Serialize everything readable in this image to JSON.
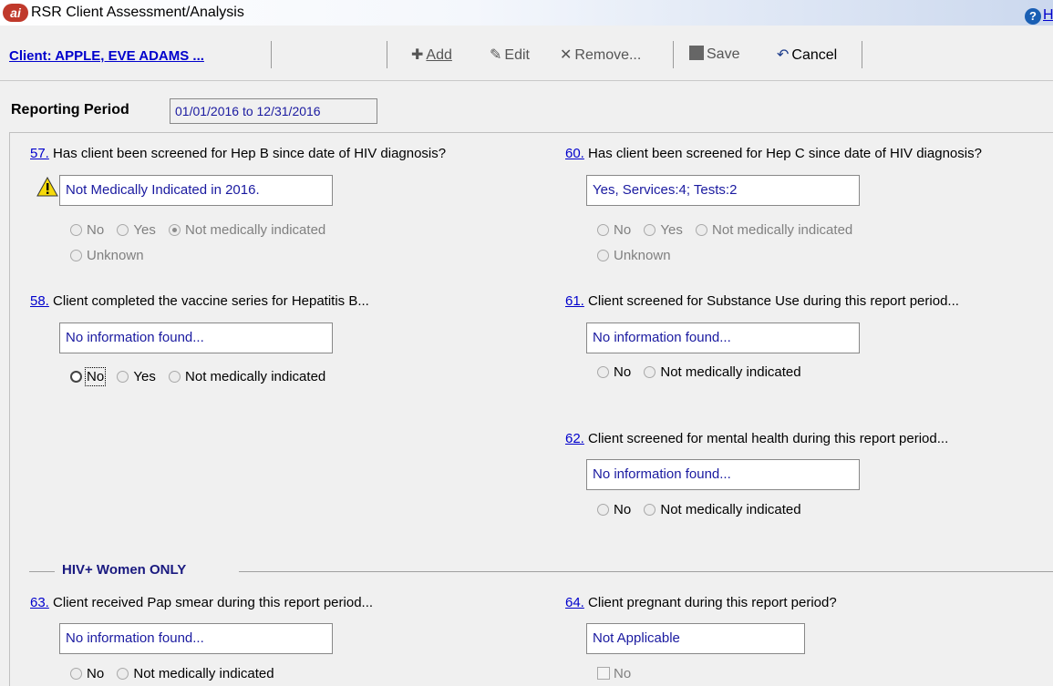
{
  "window": {
    "title": "RSR Client Assessment/Analysis",
    "logo_text": "ai"
  },
  "toolbar": {
    "client_link": "Client: APPLE, EVE ADAMS ...",
    "add": "Add",
    "edit": "Edit",
    "remove": "Remove...",
    "save": "Save",
    "cancel": "Cancel",
    "help": "H"
  },
  "reporting_period": {
    "label": "Reporting Period",
    "value": "01/01/2016 to 12/31/2016"
  },
  "questions": {
    "q57": {
      "num": "57.",
      "text": " Has client been screened for Hep B since date of HIV diagnosis?",
      "value": "Not Medically Indicated in 2016.",
      "opt_no": "No",
      "opt_yes": "Yes",
      "opt_nmi": "Not medically indicated",
      "opt_unknown": "Unknown",
      "selected": "Not medically indicated"
    },
    "q58": {
      "num": "58.",
      "text": " Client completed the vaccine series for Hepatitis B...",
      "value": "No information found...",
      "opt_no": "No",
      "opt_yes": "Yes",
      "opt_nmi": "Not medically indicated"
    },
    "q60": {
      "num": "60.",
      "text": " Has client been screened for Hep C since date of HIV diagnosis?",
      "value": "Yes, Services:4; Tests:2",
      "opt_no": "No",
      "opt_yes": "Yes",
      "opt_nmi": "Not medically indicated",
      "opt_unknown": "Unknown"
    },
    "q61": {
      "num": "61.",
      "text": " Client screened for Substance Use during this report period...",
      "value": "No information found...",
      "opt_no": "No",
      "opt_nmi": "Not medically indicated"
    },
    "q62": {
      "num": "62.",
      "text": " Client screened for mental health during this report period...",
      "value": "No information found...",
      "opt_no": "No",
      "opt_nmi": "Not medically indicated"
    },
    "q63": {
      "num": "63.",
      "text": " Client received Pap smear during this report period...",
      "value": "No information found...",
      "opt_no": "No",
      "opt_nmi": "Not medically indicated"
    },
    "q64": {
      "num": "64.",
      "text": " Client pregnant during this report period?",
      "value": "Not Applicable",
      "opt_no": "No"
    }
  },
  "section": {
    "women_title": "HIV+ Women ONLY"
  }
}
